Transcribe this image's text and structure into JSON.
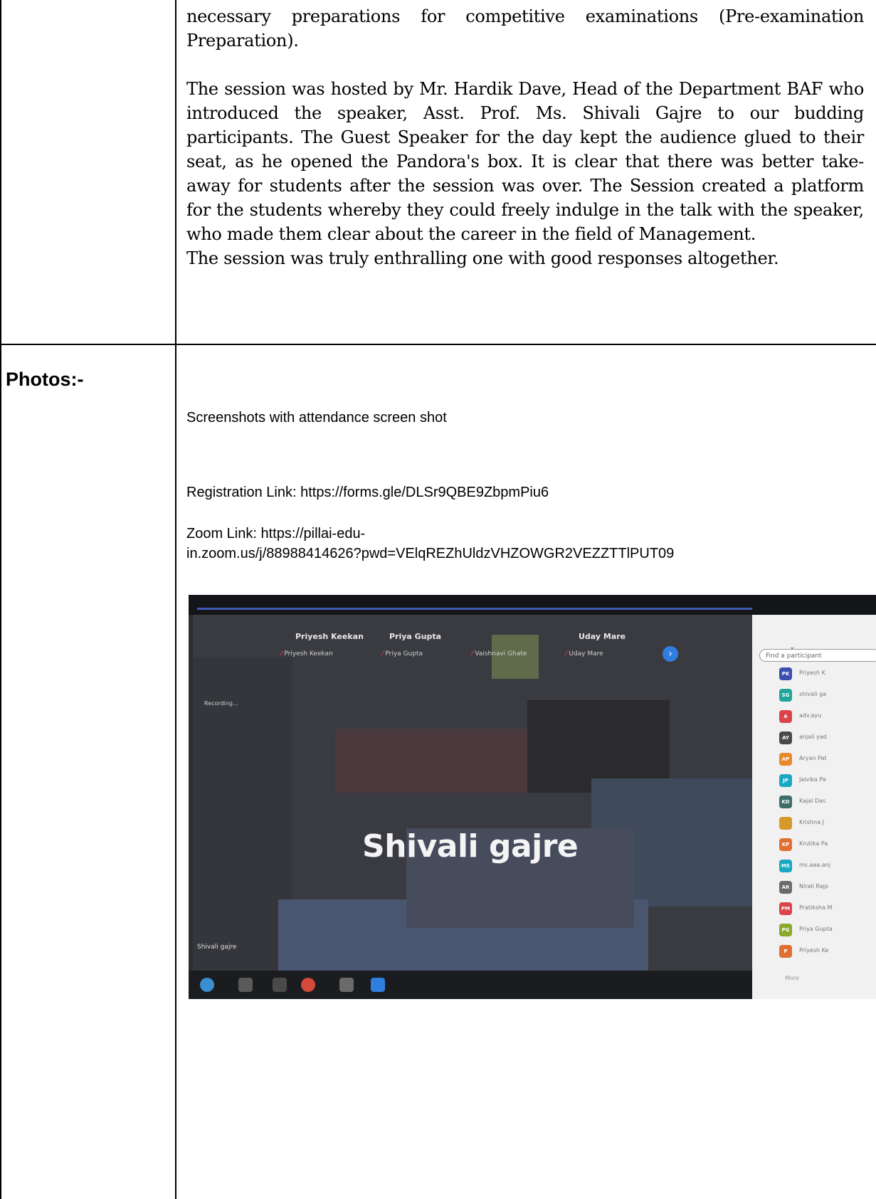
{
  "narrative": {
    "para1": "necessary preparations for competitive examinations (Pre-examination Preparation).",
    "para2": "The session was hosted by Mr. Hardik Dave, Head of the Department BAF who introduced the speaker, Asst. Prof. Ms. Shivali Gajre to our budding participants. The Guest Speaker for the day kept the audience glued to their seat, as he opened the Pandora's box. It is clear that there was better take-away for students after the session was over. The Session created a platform for the students whereby they could freely indulge in the talk with the speaker, who made them clear about the career in the field of Management.",
    "para3": "The session was truly enthralling one with good responses altogether."
  },
  "photos": {
    "label": "Photos:-",
    "caption": "Screenshots with attendance screen shot",
    "registration": "Registration Link: https://forms.gle/DLSr9QBE9ZbpmPiu6",
    "zoom_line1": "Zoom Link: https://pillai-edu-",
    "zoom_line2": "in.zoom.us/j/88988414626?pwd=VElqREZhUldzVHZOWGR2VEZZTTlPUT09"
  },
  "screenshot": {
    "tiles": [
      {
        "name": "Priyesh Keekan",
        "sub": "Priyesh Keekan"
      },
      {
        "name": "Priya Gupta",
        "sub": "Priya Gupta"
      },
      {
        "name": "",
        "sub": "Vaishnavi Ghate"
      },
      {
        "name": "Uday Mare",
        "sub": "Uday Mare"
      }
    ],
    "recording": "Recording...",
    "speaker": "Shivali gajre",
    "self_name": "Shivali gajre",
    "search_placeholder": "Find a participant",
    "participants": [
      {
        "initials": "PK",
        "name": "Priyesh K",
        "color": "#3b4fb0"
      },
      {
        "initials": "SG",
        "name": "shivali ga",
        "color": "#1fa59a"
      },
      {
        "initials": "A",
        "name": "adv.ayu",
        "color": "#d9444a"
      },
      {
        "initials": "AY",
        "name": "anjali yad",
        "color": "#4a4a4a"
      },
      {
        "initials": "AP",
        "name": "Aryan Pat",
        "color": "#e88a2c"
      },
      {
        "initials": "JP",
        "name": "Jaivika Pa",
        "color": "#1aa7c4"
      },
      {
        "initials": "KD",
        "name": "Kajal Das",
        "color": "#3d6e6a"
      },
      {
        "initials": "",
        "name": "Krishna J",
        "color": "#d69a2a"
      },
      {
        "initials": "KP",
        "name": "Krutika Pa",
        "color": "#e07030"
      },
      {
        "initials": "MS",
        "name": "ms.aaa.anj",
        "color": "#1aa7c4"
      },
      {
        "initials": "AR",
        "name": "Nirali Rajp",
        "color": "#6b6b6b"
      },
      {
        "initials": "PM",
        "name": "Pratiksha M",
        "color": "#d9444a"
      },
      {
        "initials": "PG",
        "name": "Priya Gupta",
        "color": "#8aa82c"
      },
      {
        "initials": "P",
        "name": "Priyesh Ke",
        "color": "#e07030"
      }
    ],
    "more": "More"
  }
}
